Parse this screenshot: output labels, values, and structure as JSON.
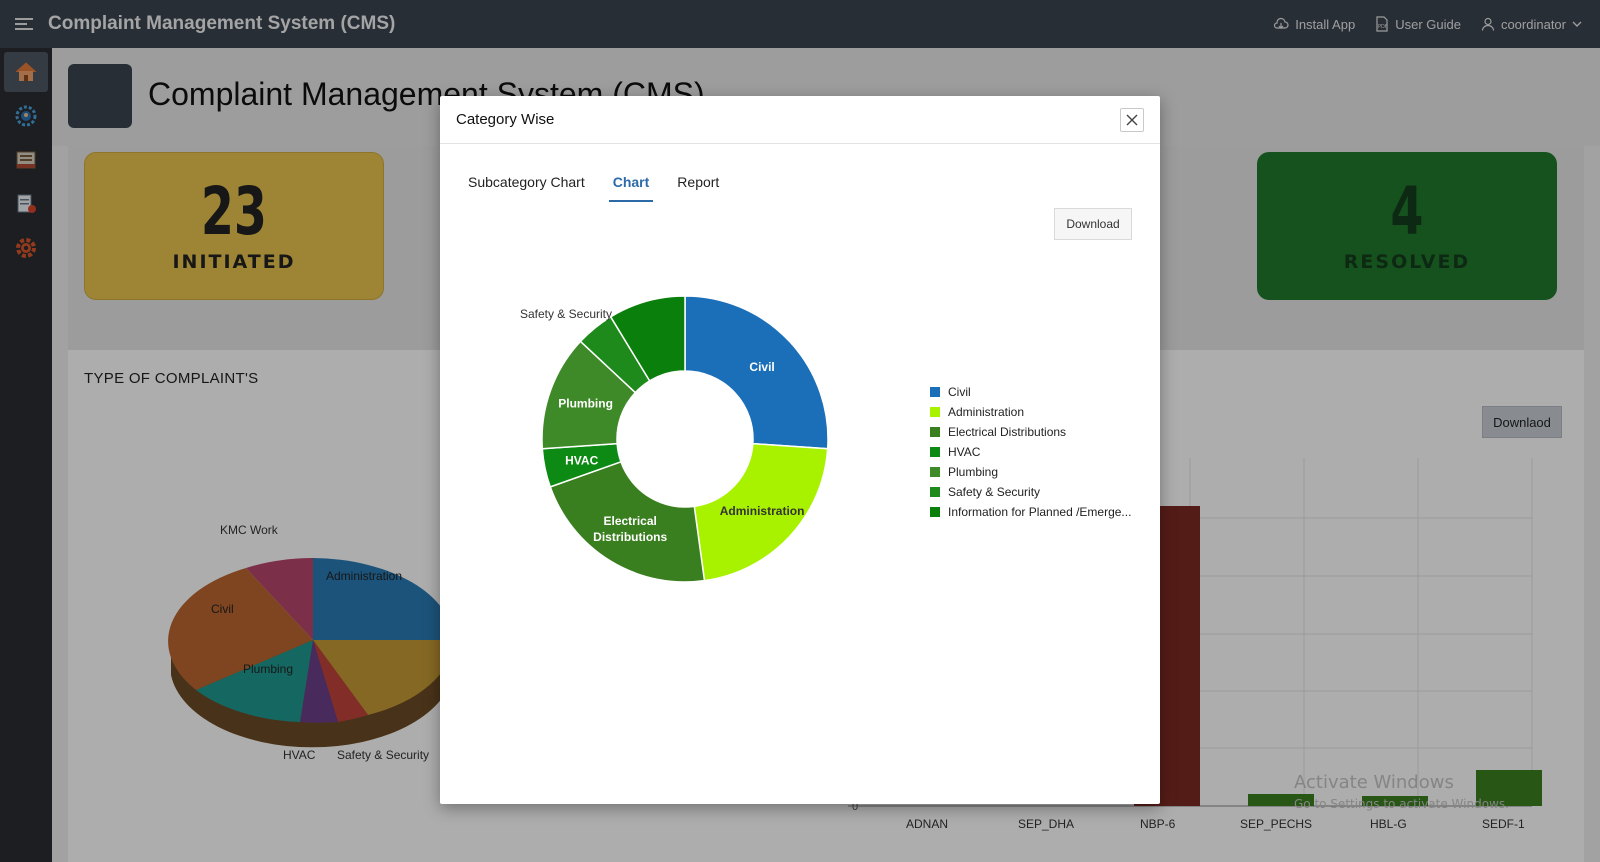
{
  "app": {
    "title": "Complaint Management System (CMS)"
  },
  "top_actions": {
    "install": "Install App",
    "guide": "User Guide",
    "user": "coordinator"
  },
  "sidebar": {
    "items": [
      {
        "icon": "home-icon"
      },
      {
        "icon": "cog-users-icon"
      },
      {
        "icon": "register-icon"
      },
      {
        "icon": "report-icon"
      },
      {
        "icon": "settings-gear-icon"
      }
    ]
  },
  "page": {
    "title": "Complaint Management System (CMS)"
  },
  "stats": [
    {
      "value": "23",
      "label": "INITIATED",
      "color": "#e8c44f"
    },
    {
      "value": "4",
      "label": "RESOLVED",
      "color": "#1f7a2c"
    }
  ],
  "complaints_panel": {
    "title": "TYPE OF COMPLAINT'S",
    "download_label": "Downlaod",
    "pie_labels": [
      "KMC Work",
      "Administration",
      "Civil",
      "Plumbing",
      "HVAC",
      "Safety & Security"
    ],
    "bar_categories": [
      "ADNAN",
      "SEP_DHA",
      "NBP-6",
      "SEP_PECHS",
      "HBL-G",
      "SEDF-1"
    ],
    "bar_zero_label": "0",
    "watermark": [
      "Activate Windows",
      "Go to Settings to activate Windows."
    ]
  },
  "modal": {
    "title": "Category Wise",
    "tabs": [
      "Subcategory Chart",
      "Chart",
      "Report"
    ],
    "active_tab": "Chart",
    "download_label": "Download"
  },
  "chart_data": {
    "type": "pie",
    "style": "donut",
    "title": "",
    "labels": [
      "Civil",
      "Administration",
      "Electrical Distributions",
      "HVAC",
      "Plumbing",
      "Safety & Security",
      "Information for Planned /Emerge..."
    ],
    "values": [
      6,
      5,
      5,
      1,
      3,
      1,
      2
    ],
    "colors": [
      "#1b6fb8",
      "#a8f200",
      "#3a7f1f",
      "#0c8a14",
      "#3f8a28",
      "#1f8a1c",
      "#0b7f0b"
    ],
    "slice_labels": [
      "Civil",
      "Administration",
      "Electrical\nDistributions",
      "HVAC",
      "Plumbing",
      "Safety & Security",
      ""
    ],
    "legend_position": "right"
  }
}
